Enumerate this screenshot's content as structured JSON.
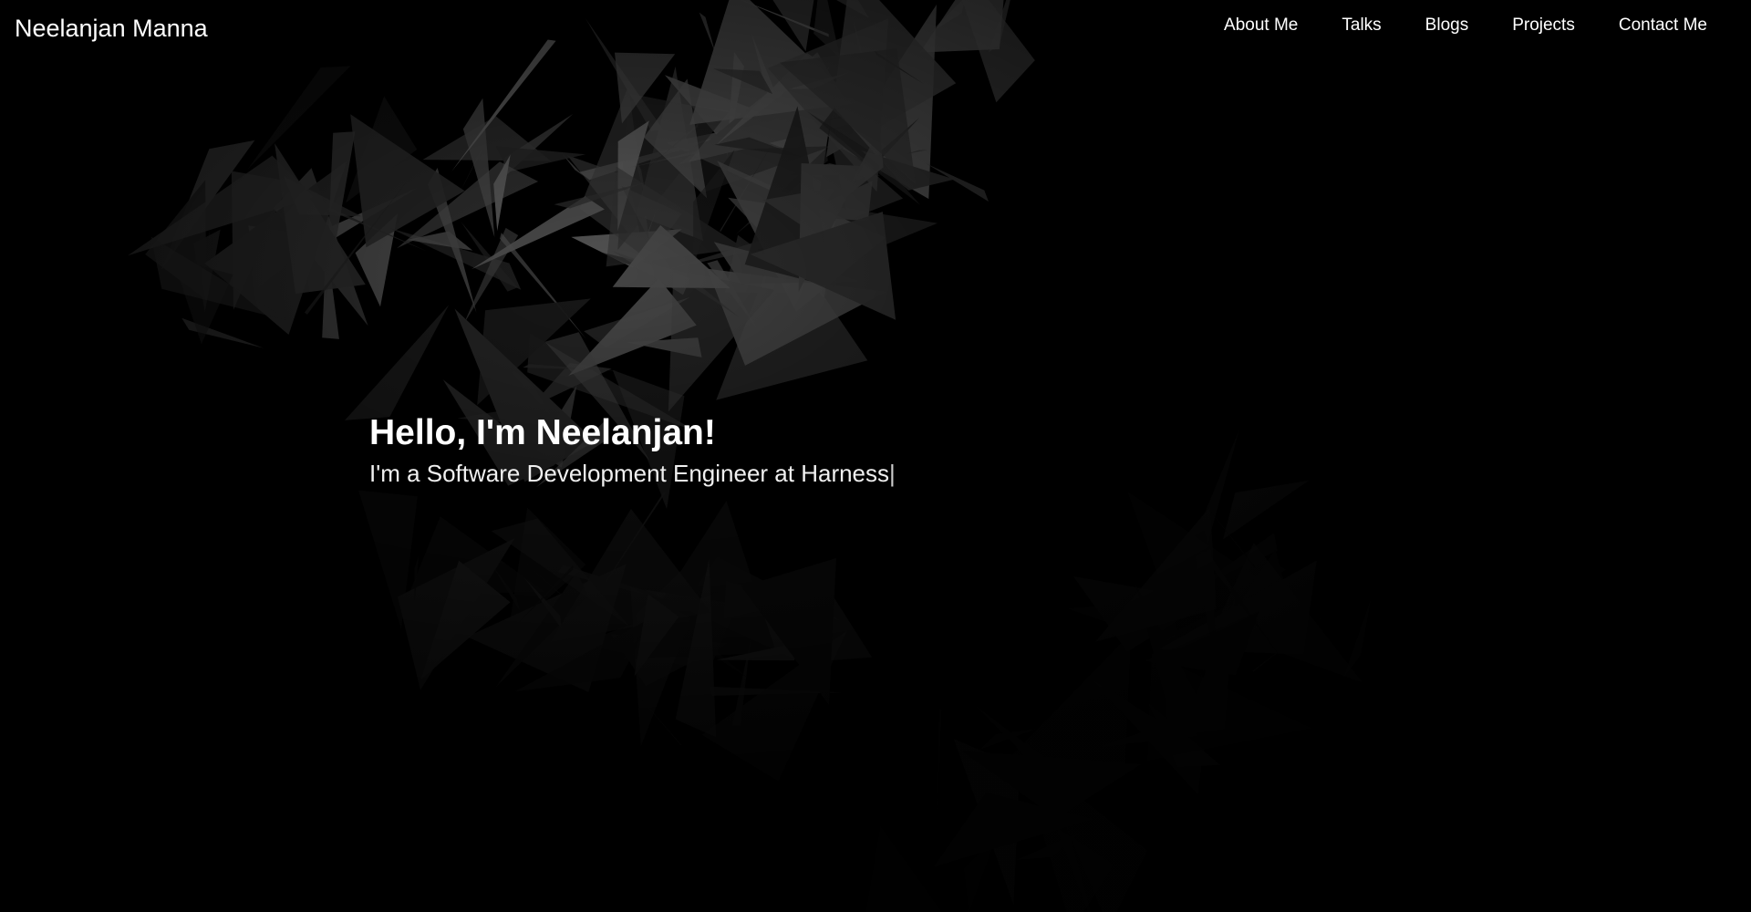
{
  "header": {
    "brand": "Neelanjan Manna",
    "nav": [
      {
        "label": "About Me"
      },
      {
        "label": "Talks"
      },
      {
        "label": "Blogs"
      },
      {
        "label": "Projects"
      },
      {
        "label": "Contact Me"
      }
    ]
  },
  "hero": {
    "title": "Hello, I'm Neelanjan!",
    "subtitle": "I'm a Software Development Engineer at Harness",
    "cursor": "|"
  },
  "theme": {
    "background": "#000000",
    "text": "#ffffff"
  }
}
